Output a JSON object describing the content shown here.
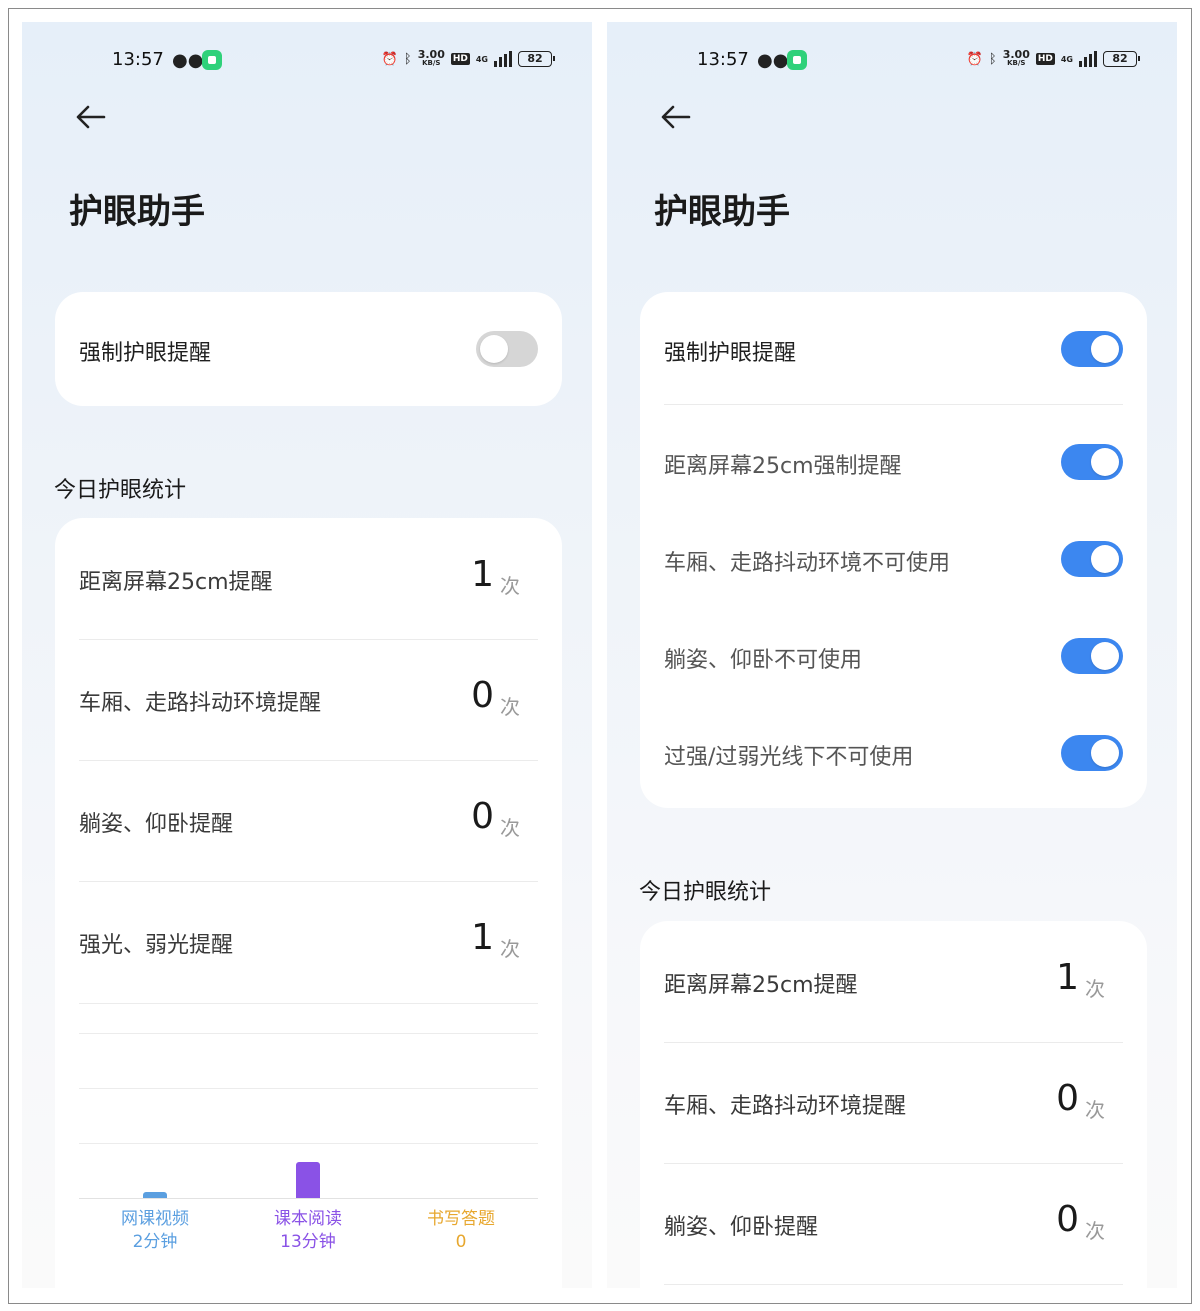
{
  "colors": {
    "toggle_on": "#3c87f0",
    "toggle_off": "#d6d6d6",
    "video": "#5b9fe0",
    "reading": "#8a52e6",
    "writing": "#e7a72e"
  },
  "status_bar": {
    "time": "13:57",
    "net_speed": "3.00",
    "net_unit": "KB/S",
    "hd": "HD",
    "network": "4G",
    "battery": "82"
  },
  "left": {
    "title": "护眼助手",
    "force_reminder": {
      "label": "强制护眼提醒",
      "enabled": false
    },
    "stats_title": "今日护眼统计",
    "stats": [
      {
        "label": "距离屏幕25cm提醒",
        "value": "1",
        "unit": "次"
      },
      {
        "label": "车厢、走路抖动环境提醒",
        "value": "0",
        "unit": "次"
      },
      {
        "label": "躺姿、仰卧提醒",
        "value": "0",
        "unit": "次"
      },
      {
        "label": "强光、弱光提醒",
        "value": "1",
        "unit": "次"
      }
    ],
    "chart_data": {
      "type": "bar",
      "categories": [
        "网课视频",
        "课本阅读",
        "书写答题"
      ],
      "series": [
        {
          "values": [
            2,
            13,
            0
          ]
        }
      ],
      "value_labels": [
        "2分钟",
        "13分钟",
        "0"
      ],
      "ylim": [
        0,
        60
      ],
      "grid": true
    }
  },
  "right": {
    "title": "护眼助手",
    "force_reminder": {
      "label": "强制护眼提醒",
      "enabled": true
    },
    "sub_toggles": [
      {
        "label": "距离屏幕25cm强制提醒",
        "enabled": true
      },
      {
        "label": "车厢、走路抖动环境不可使用",
        "enabled": true
      },
      {
        "label": "躺姿、仰卧不可使用",
        "enabled": true
      },
      {
        "label": "过强/过弱光线下不可使用",
        "enabled": true
      }
    ],
    "stats_title": "今日护眼统计",
    "stats": [
      {
        "label": "距离屏幕25cm提醒",
        "value": "1",
        "unit": "次"
      },
      {
        "label": "车厢、走路抖动环境提醒",
        "value": "0",
        "unit": "次"
      },
      {
        "label": "躺姿、仰卧提醒",
        "value": "0",
        "unit": "次"
      }
    ]
  }
}
